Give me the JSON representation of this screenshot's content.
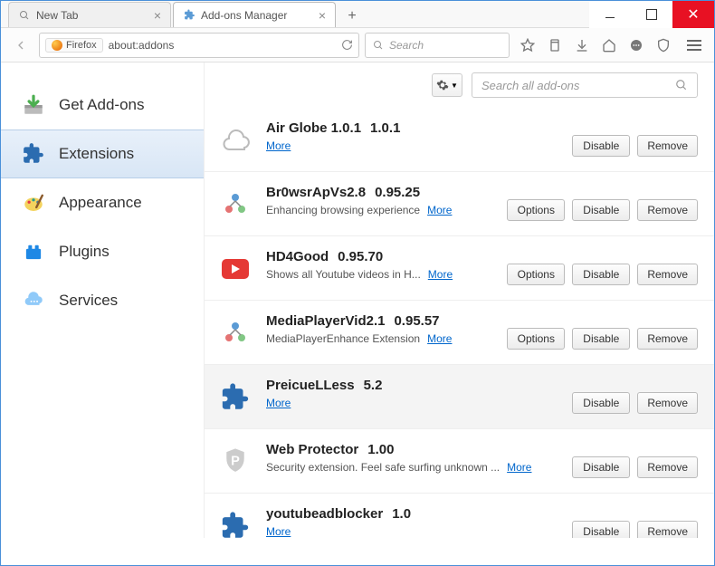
{
  "window": {
    "close": "✕"
  },
  "tabs": [
    {
      "label": "New Tab"
    },
    {
      "label": "Add-ons Manager"
    }
  ],
  "urlbar": {
    "badge": "Firefox",
    "value": "about:addons"
  },
  "search": {
    "placeholder": "Search"
  },
  "sidebar": {
    "items": [
      {
        "label": "Get Add-ons"
      },
      {
        "label": "Extensions"
      },
      {
        "label": "Appearance"
      },
      {
        "label": "Plugins"
      },
      {
        "label": "Services"
      }
    ]
  },
  "addon_search": {
    "placeholder": "Search all add-ons"
  },
  "buttons": {
    "options": "Options",
    "disable": "Disable",
    "remove": "Remove",
    "more": "More"
  },
  "addons": [
    {
      "name": "Air Globe 1.0.1",
      "version": "1.0.1",
      "desc": "",
      "has_options": false
    },
    {
      "name": "Br0wsrApVs2.8",
      "version": "0.95.25",
      "desc": "Enhancing browsing experience",
      "has_options": true
    },
    {
      "name": "HD4Good",
      "version": "0.95.70",
      "desc": "Shows all Youtube videos in H...",
      "has_options": true
    },
    {
      "name": "MediaPlayerVid2.1",
      "version": "0.95.57",
      "desc": "MediaPlayerEnhance Extension",
      "has_options": true
    },
    {
      "name": "PreicueLLess",
      "version": "5.2",
      "desc": "",
      "has_options": false
    },
    {
      "name": "Web Protector",
      "version": "1.00",
      "desc": "Security extension. Feel safe surfing unknown ...",
      "has_options": false
    },
    {
      "name": "youtubeadblocker",
      "version": "1.0",
      "desc": "",
      "has_options": false
    }
  ]
}
